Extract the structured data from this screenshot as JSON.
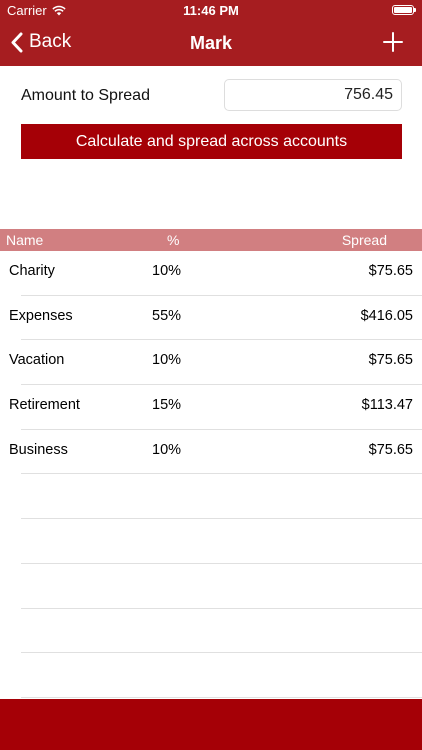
{
  "status_bar": {
    "carrier": "Carrier",
    "time": "11:46 PM"
  },
  "nav": {
    "back_label": "Back",
    "title": "Mark"
  },
  "amount": {
    "label": "Amount to Spread",
    "value": "756.45"
  },
  "calculate_button": "Calculate and spread across accounts",
  "table": {
    "headers": {
      "name": "Name",
      "percent": "%",
      "spread": "Spread"
    },
    "rows": [
      {
        "name": "Charity",
        "percent": "10%",
        "spread": "$75.65"
      },
      {
        "name": "Expenses",
        "percent": "55%",
        "spread": "$416.05"
      },
      {
        "name": "Vacation",
        "percent": "10%",
        "spread": "$75.65"
      },
      {
        "name": "Retirement",
        "percent": "15%",
        "spread": "$113.47"
      },
      {
        "name": "Business",
        "percent": "10%",
        "spread": "$75.65"
      }
    ],
    "empty_rows": 5
  },
  "icons": {
    "wifi": "wifi-icon",
    "battery": "battery-icon",
    "back": "chevron-left-icon",
    "add": "plus-icon"
  },
  "colors": {
    "nav_bar": "#a61d20",
    "button": "#a50006",
    "table_header": "#d17f81",
    "bottom_bar": "#a50006"
  }
}
